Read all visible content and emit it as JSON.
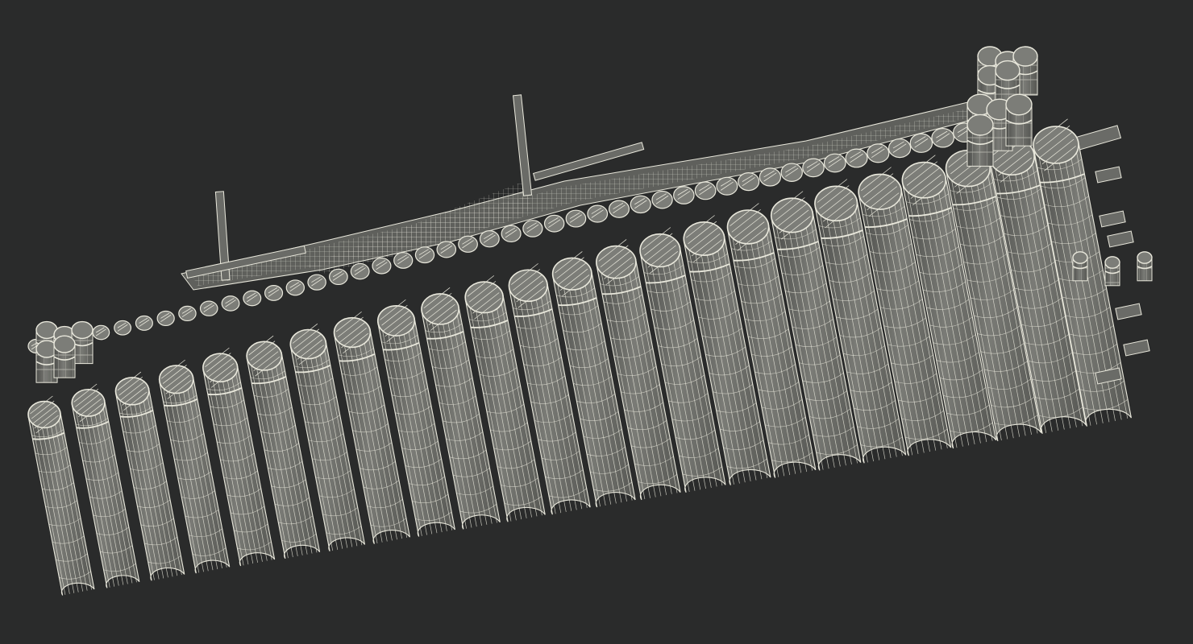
{
  "scene": {
    "subject": "bamboo-raft-wireframe",
    "colors": {
      "background": "#2a2b2b",
      "log_fill": "#6f706c",
      "log_fill_dark": "#595a57",
      "wire": "#e9e8dc",
      "cap_fill": "#7c7d78"
    }
  }
}
